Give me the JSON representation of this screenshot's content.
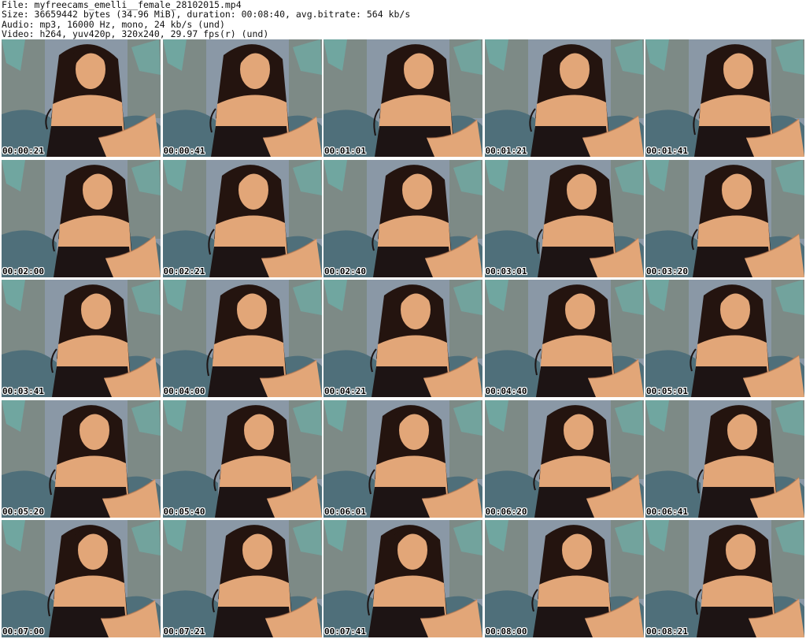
{
  "header": {
    "file_line": "File: myfreecams_emelli__female_28102015.mp4",
    "size_line": "Size: 36659442 bytes (34.96 MiB), duration: 00:08:40, avg.bitrate: 564 kb/s",
    "audio_line": "Audio: mp3, 16000 Hz, mono, 24 kb/s (und)",
    "video_line": "Video: h264, yuv420p, 320x240, 29.97 fps(r) (und)"
  },
  "thumbnails": [
    {
      "timestamp": "00:00:21"
    },
    {
      "timestamp": "00:00:41"
    },
    {
      "timestamp": "00:01:01"
    },
    {
      "timestamp": "00:01:21"
    },
    {
      "timestamp": "00:01:41"
    },
    {
      "timestamp": "00:02:00"
    },
    {
      "timestamp": "00:02:21"
    },
    {
      "timestamp": "00:02:40"
    },
    {
      "timestamp": "00:03:01"
    },
    {
      "timestamp": "00:03:20"
    },
    {
      "timestamp": "00:03:41"
    },
    {
      "timestamp": "00:04:00"
    },
    {
      "timestamp": "00:04:21"
    },
    {
      "timestamp": "00:04:40"
    },
    {
      "timestamp": "00:05:01"
    },
    {
      "timestamp": "00:05:20"
    },
    {
      "timestamp": "00:05:40"
    },
    {
      "timestamp": "00:06:01"
    },
    {
      "timestamp": "00:06:20"
    },
    {
      "timestamp": "00:06:41"
    },
    {
      "timestamp": "00:07:00"
    },
    {
      "timestamp": "00:07:21"
    },
    {
      "timestamp": "00:07:41"
    },
    {
      "timestamp": "00:08:00"
    },
    {
      "timestamp": "00:08:21"
    }
  ],
  "colors": {
    "wall": "#8a98a6",
    "curtain": "#7d8a86",
    "leaf": "#6fa9a3",
    "sofa": "#4f6f7a",
    "skin": "#e2a678",
    "skin_shadow": "#b9784f",
    "hair": "#24140f",
    "dress": "#1d1414"
  }
}
